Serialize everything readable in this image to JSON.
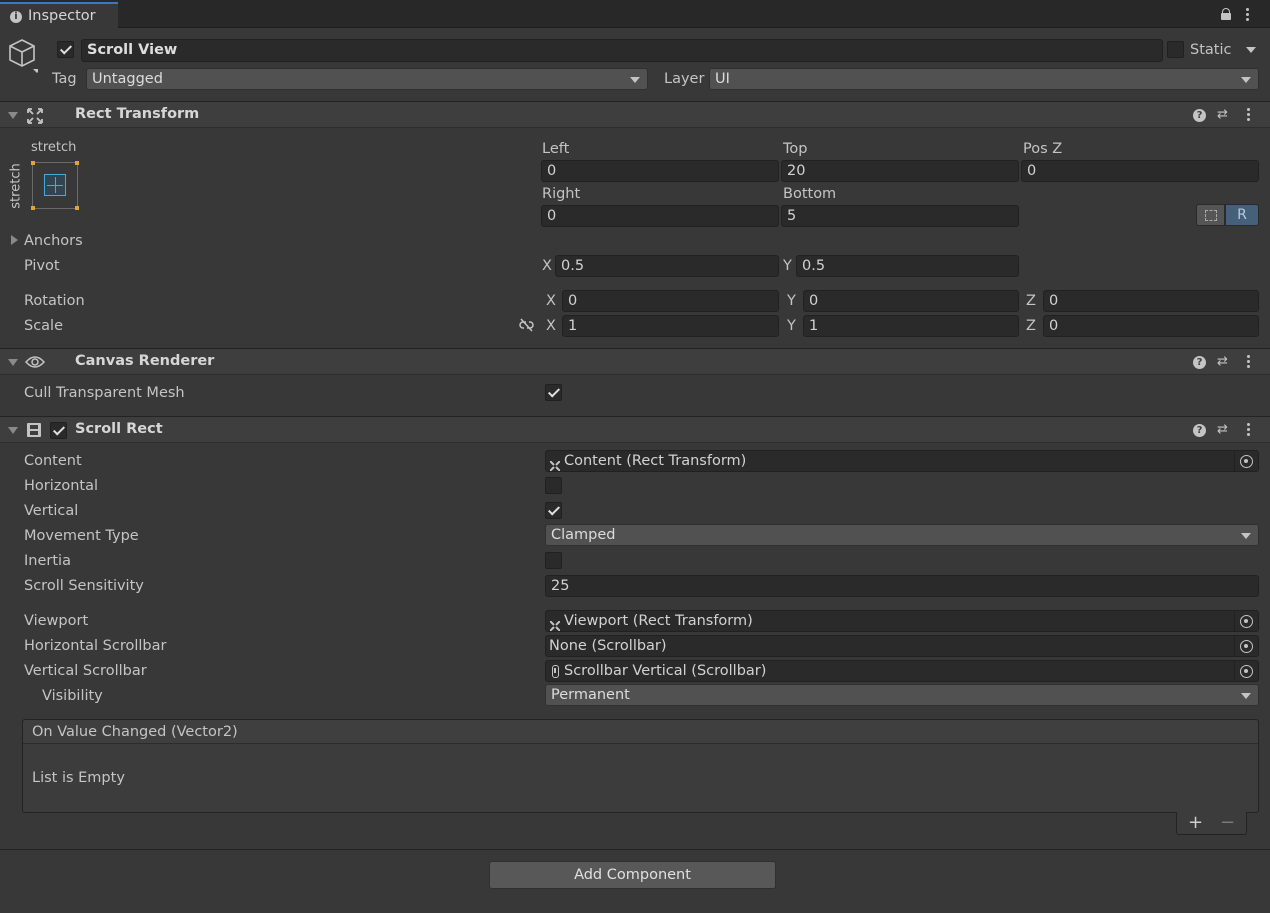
{
  "tab": {
    "title": "Inspector"
  },
  "object": {
    "name": "Scroll View",
    "static_label": "Static",
    "tag_label": "Tag",
    "tag_value": "Untagged",
    "layer_label": "Layer",
    "layer_value": "UI"
  },
  "rect_transform": {
    "title": "Rect Transform",
    "anchor_h": "stretch",
    "anchor_v": "stretch",
    "left_label": "Left",
    "left_value": "0",
    "top_label": "Top",
    "top_value": "20",
    "posz_label": "Pos Z",
    "posz_value": "0",
    "right_label": "Right",
    "right_value": "0",
    "bottom_label": "Bottom",
    "bottom_value": "5",
    "r_button": "R",
    "anchors_label": "Anchors",
    "pivot_label": "Pivot",
    "pivot_x": "0.5",
    "pivot_y": "0.5",
    "rotation_label": "Rotation",
    "rot_x": "0",
    "rot_y": "0",
    "rot_z": "0",
    "scale_label": "Scale",
    "scale_x": "1",
    "scale_y": "1",
    "scale_z": "0",
    "x": "X",
    "y": "Y",
    "z": "Z"
  },
  "canvas_renderer": {
    "title": "Canvas Renderer",
    "cull_label": "Cull Transparent Mesh",
    "cull_checked": true
  },
  "scroll_rect": {
    "title": "Scroll Rect",
    "content_label": "Content",
    "content_value": "Content (Rect Transform)",
    "horizontal_label": "Horizontal",
    "horizontal_checked": false,
    "vertical_label": "Vertical",
    "vertical_checked": true,
    "movement_label": "Movement Type",
    "movement_value": "Clamped",
    "inertia_label": "Inertia",
    "inertia_checked": false,
    "sensitivity_label": "Scroll Sensitivity",
    "sensitivity_value": "25",
    "viewport_label": "Viewport",
    "viewport_value": "Viewport (Rect Transform)",
    "hscroll_label": "Horizontal Scrollbar",
    "hscroll_value": "None (Scrollbar)",
    "vscroll_label": "Vertical Scrollbar",
    "vscroll_value": "Scrollbar Vertical (Scrollbar)",
    "visibility_label": "Visibility",
    "visibility_value": "Permanent",
    "event_title": "On Value Changed (Vector2)",
    "event_empty": "List is Empty",
    "plus": "+",
    "minus": "−"
  },
  "add_component": "Add Component"
}
